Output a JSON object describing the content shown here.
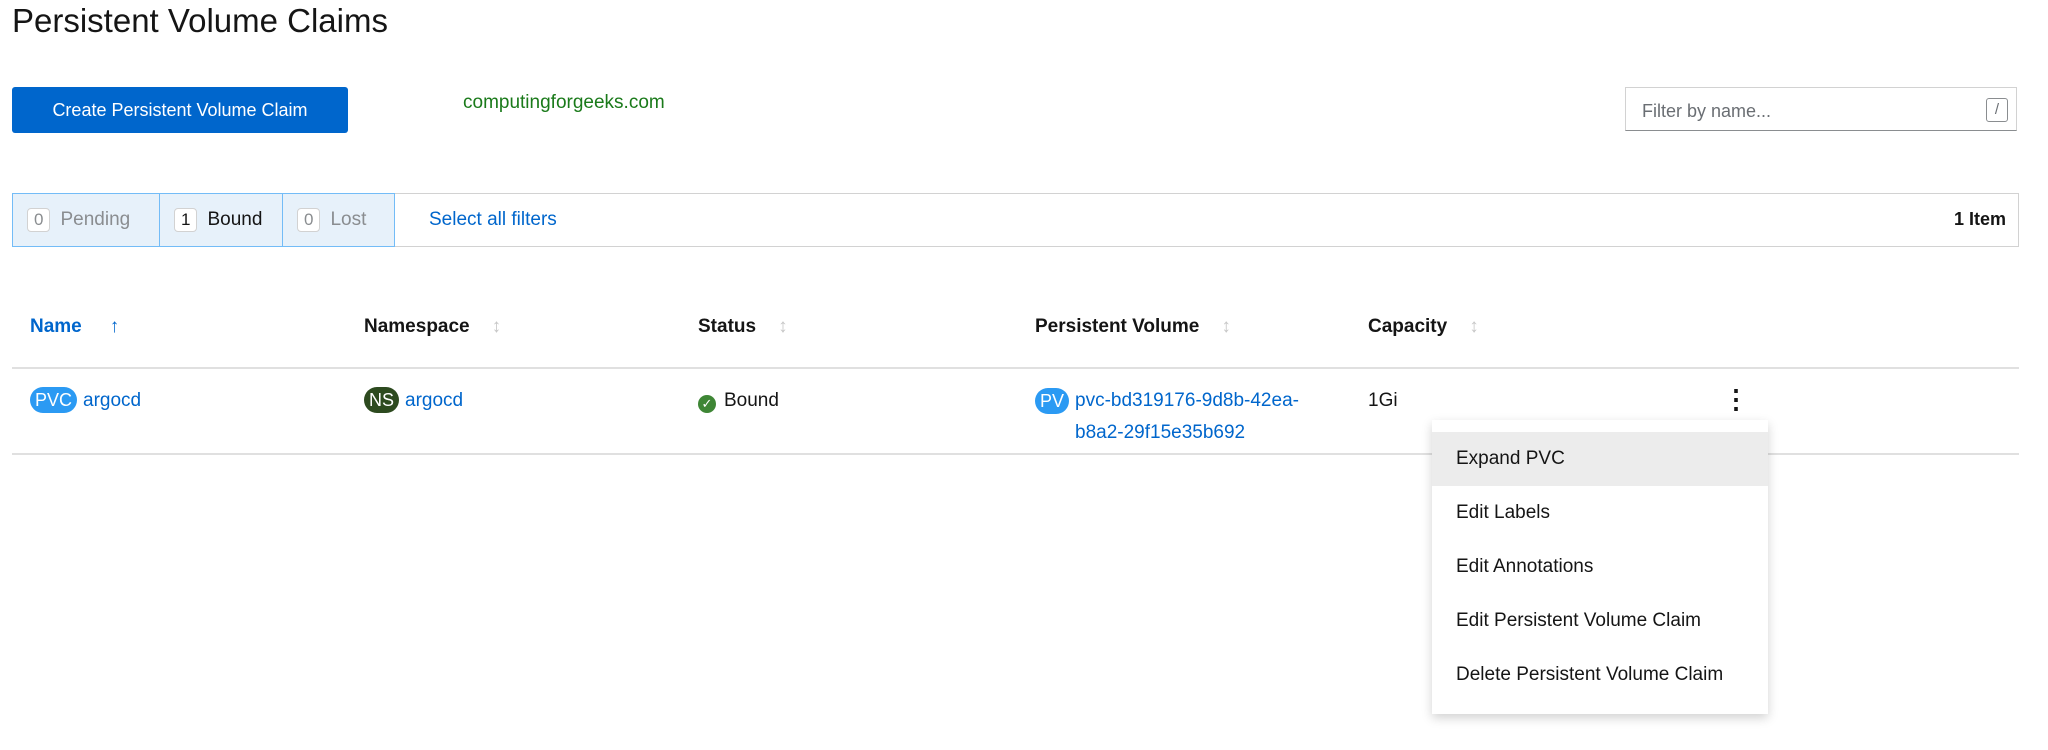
{
  "page": {
    "title": "Persistent Volume Claims",
    "create_button": "Create Persistent Volume Claim",
    "watermark": "computingforgeeks.com"
  },
  "filter": {
    "placeholder": "Filter by name...",
    "shortcut": "/"
  },
  "status_filters": [
    {
      "count": "0",
      "label": "Pending",
      "active": false
    },
    {
      "count": "1",
      "label": "Bound",
      "active": true
    },
    {
      "count": "0",
      "label": "Lost",
      "active": false
    }
  ],
  "select_all": "Select all filters",
  "item_count": "1 Item",
  "columns": [
    "Name",
    "Namespace",
    "Status",
    "Persistent Volume",
    "Capacity"
  ],
  "row": {
    "kind_badge": "PVC",
    "name": "argocd",
    "ns_badge": "NS",
    "namespace": "argocd",
    "status": "Bound",
    "pv_badge": "PV",
    "pv_line1": "pvc-bd319176-9d8b-42ea-",
    "pv_line2": "b8a2-29f15e35b692",
    "capacity": "1Gi"
  },
  "menu": [
    "Expand PVC",
    "Edit Labels",
    "Edit Annotations",
    "Edit Persistent Volume Claim",
    "Delete Persistent Volume Claim"
  ],
  "colors": {
    "primary": "#0066cc",
    "pvc_badge": "#2b9af3",
    "ns_badge": "#2d4a1f",
    "bound": "#3e8635"
  }
}
